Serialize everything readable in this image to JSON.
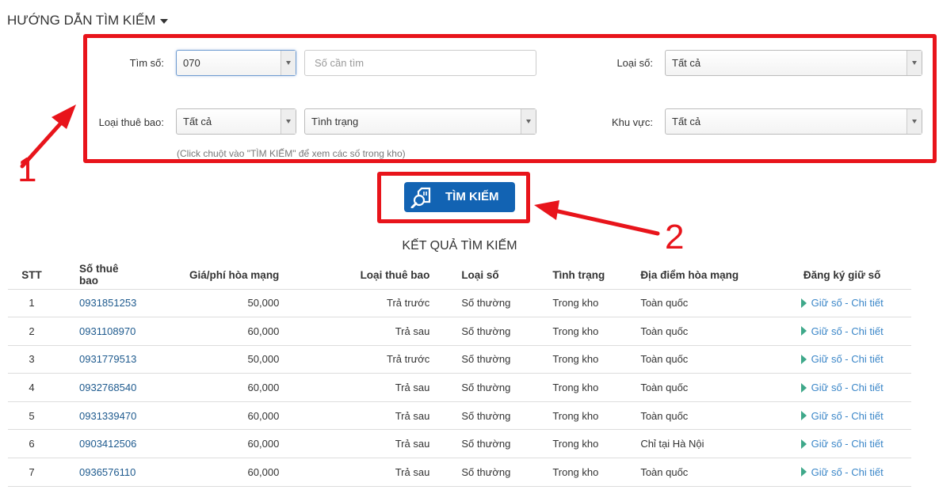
{
  "guide": {
    "title": "HƯỚNG DẪN TÌM KIẾM"
  },
  "form": {
    "tim_so_label": "Tìm số:",
    "tim_so_value": "070",
    "search_placeholder": "Số cần tìm",
    "loai_so_label": "Loại số:",
    "loai_so_value": "Tất cả",
    "loai_thue_bao_label": "Loại thuê bao:",
    "loai_thue_bao_value": "Tất cả",
    "tinh_trang_value": "Tình trạng",
    "khu_vuc_label": "Khu vực:",
    "khu_vuc_value": "Tất cả",
    "hint": "(Click chuột vào \"TÌM KIẾM\" để xem các số trong kho)"
  },
  "search_button": {
    "label": "TÌM KIẾM"
  },
  "annotations": {
    "one": "1",
    "two": "2",
    "accent": "#e8141b"
  },
  "results": {
    "title": "KẾT QUẢ TÌM KIẾM",
    "headers": [
      "STT",
      "Số thuê bao",
      "Giá/phí hòa mạng",
      "Loại thuê bao",
      "Loại số",
      "Tình trạng",
      "Địa điểm hòa mạng",
      "Đăng ký giữ số"
    ],
    "rows": [
      [
        "1",
        "0931851253",
        "50,000",
        "Trả trước",
        "Số thường",
        "Trong kho",
        "Toàn quốc",
        "Giữ số - Chi tiết"
      ],
      [
        "2",
        "0931108970",
        "60,000",
        "Trả sau",
        "Số thường",
        "Trong kho",
        "Toàn quốc",
        "Giữ số - Chi tiết"
      ],
      [
        "3",
        "0931779513",
        "50,000",
        "Trả trước",
        "Số thường",
        "Trong kho",
        "Toàn quốc",
        "Giữ số - Chi tiết"
      ],
      [
        "4",
        "0932768540",
        "60,000",
        "Trả sau",
        "Số thường",
        "Trong kho",
        "Toàn quốc",
        "Giữ số - Chi tiết"
      ],
      [
        "5",
        "0931339470",
        "60,000",
        "Trả sau",
        "Số thường",
        "Trong kho",
        "Toàn quốc",
        "Giữ số - Chi tiết"
      ],
      [
        "6",
        "0903412506",
        "60,000",
        "Trả sau",
        "Số thường",
        "Trong kho",
        "Chỉ tại Hà Nội",
        "Giữ số - Chi tiết"
      ],
      [
        "7",
        "0936576110",
        "60,000",
        "Trả sau",
        "Số thường",
        "Trong kho",
        "Toàn quốc",
        "Giữ số - Chi tiết"
      ]
    ]
  }
}
